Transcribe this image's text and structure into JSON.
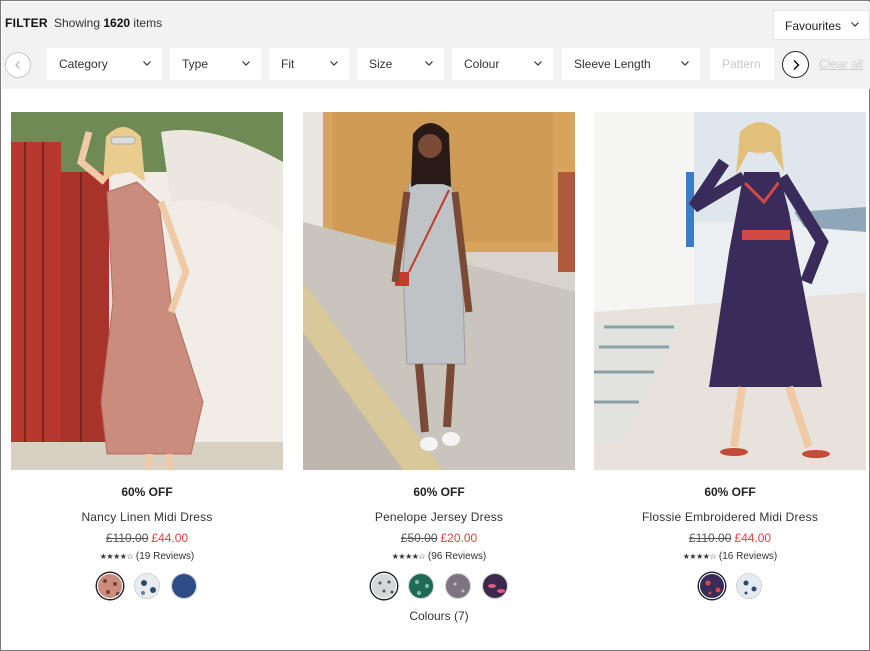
{
  "filter": {
    "label": "FILTER",
    "count_prefix": "Showing ",
    "count_value": "1620",
    "count_suffix": " items",
    "sort": "Favourites",
    "chips": [
      "Category",
      "Type",
      "Fit",
      "Size",
      "Colour",
      "Sleeve Length",
      "Pattern"
    ],
    "clear_all": "Clear all"
  },
  "products": [
    {
      "discount": "60% OFF",
      "name": "Nancy Linen Midi Dress",
      "was_price": "£110.00",
      "now_price": "£44.00",
      "stars": "★★★★☆",
      "reviews": "(19 Reviews)",
      "rating": 4,
      "swatches": [
        "#c98c7d",
        "#d7dde2",
        "#2e4c85"
      ],
      "colours_link": ""
    },
    {
      "discount": "60% OFF",
      "name": "Penelope Jersey Dress",
      "was_price": "£50.00",
      "now_price": "£20.00",
      "stars": "★★★★☆",
      "reviews": "(96 Reviews)",
      "rating": 4,
      "swatches": [
        "#d5d8d8",
        "#1f6a55",
        "#7c7480",
        "#3b2a4a"
      ],
      "colours_link": "Colours (7)"
    },
    {
      "discount": "60% OFF",
      "name": "Flossie Embroidered Midi Dress",
      "was_price": "£110.00",
      "now_price": "£44.00",
      "stars": "★★★★☆",
      "reviews": "(16 Reviews)",
      "rating": 4,
      "swatches": [
        "#3a2c5a",
        "#e4ebf0"
      ],
      "colours_link": ""
    }
  ],
  "colors": {
    "sale_red": "#e0453c",
    "bar_bg": "#f2f2f2"
  }
}
